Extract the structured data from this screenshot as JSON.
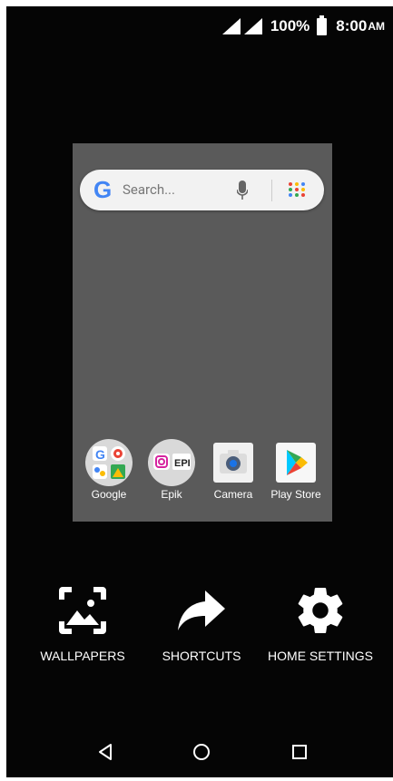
{
  "status_bar": {
    "battery": "100%",
    "time": "8:00",
    "ampm": "AM"
  },
  "preview": {
    "search": {
      "logo": "G",
      "placeholder": "Search..."
    },
    "apps": [
      {
        "label": "Google",
        "icon": "google-folder-icon"
      },
      {
        "label": "Epik",
        "icon": "epik-folder-icon"
      },
      {
        "label": "Camera",
        "icon": "camera-icon"
      },
      {
        "label": "Play Store",
        "icon": "play-store-icon"
      }
    ]
  },
  "options": {
    "wallpapers": "WALLPAPERS",
    "shortcuts": "SHORTCUTS",
    "home_settings": "HOME SETTINGS"
  },
  "nav": {
    "back": "back-icon",
    "home": "home-icon",
    "recents": "recents-icon"
  },
  "colors": {
    "screen_bg": "#050505",
    "preview_bg": "#5a5a5a",
    "google_blue": "#4285f4"
  }
}
